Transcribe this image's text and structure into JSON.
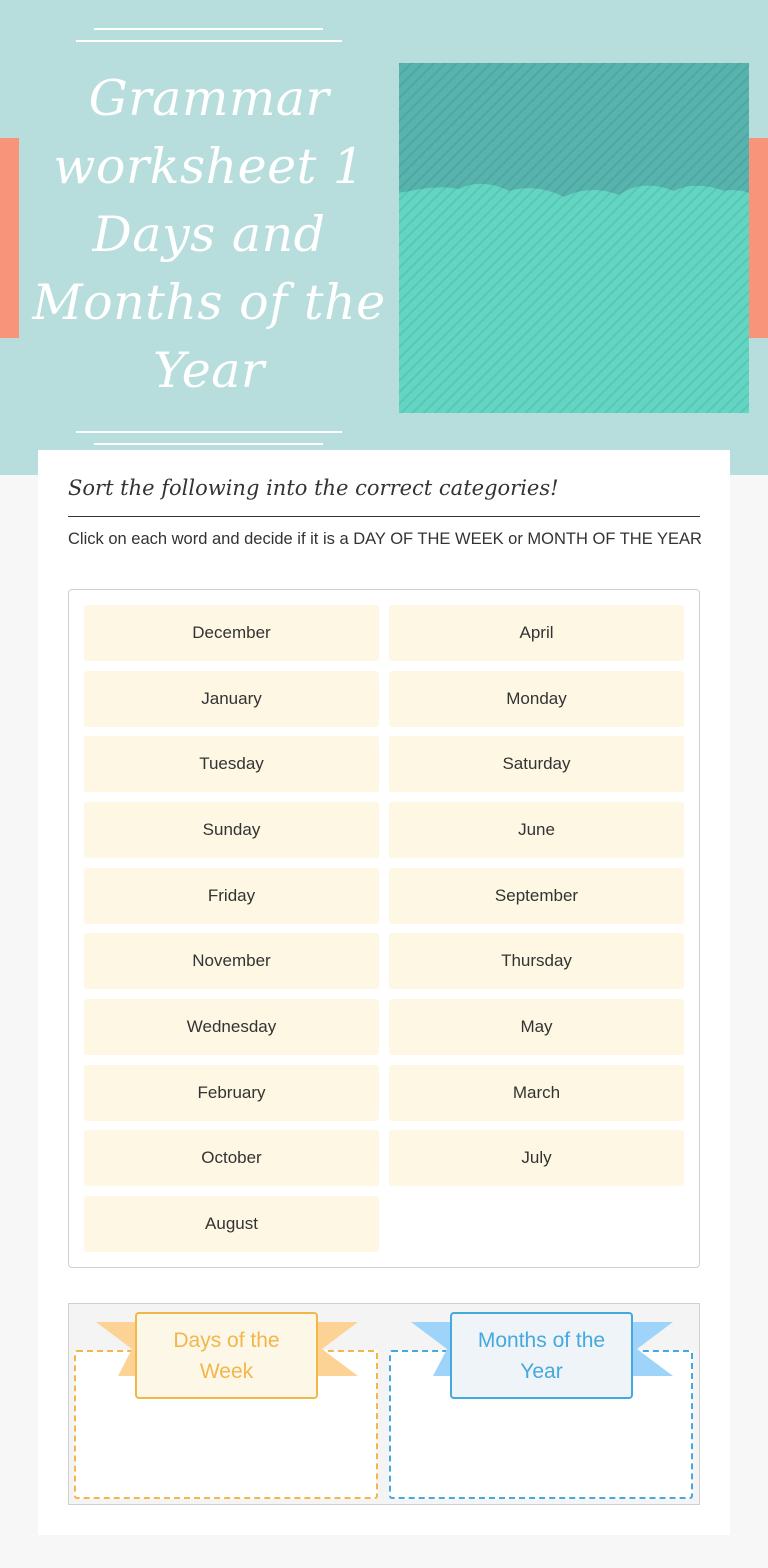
{
  "header": {
    "title": "Grammar worksheet 1 Days and Months of the Year"
  },
  "colors": {
    "header_bg": "#b7dddd",
    "accent_tab": "#f79479",
    "word_tile": "#fdf7e3",
    "days_accent": "#f3b64a",
    "months_accent": "#45a9e0"
  },
  "activity": {
    "heading": "Sort the following into the correct categories!",
    "instructions": "Click on each word and decide if it is a DAY OF THE WEEK or MONTH OF THE YEAR",
    "words": [
      "December",
      "April",
      "January",
      "Monday",
      "Tuesday",
      "Saturday",
      "Sunday",
      "June",
      "Friday",
      "September",
      "November",
      "Thursday",
      "Wednesday",
      "May",
      "February",
      "March",
      "October",
      "July",
      "August"
    ],
    "categories": {
      "days": "Days of the Week",
      "months": "Months of the Year"
    }
  }
}
